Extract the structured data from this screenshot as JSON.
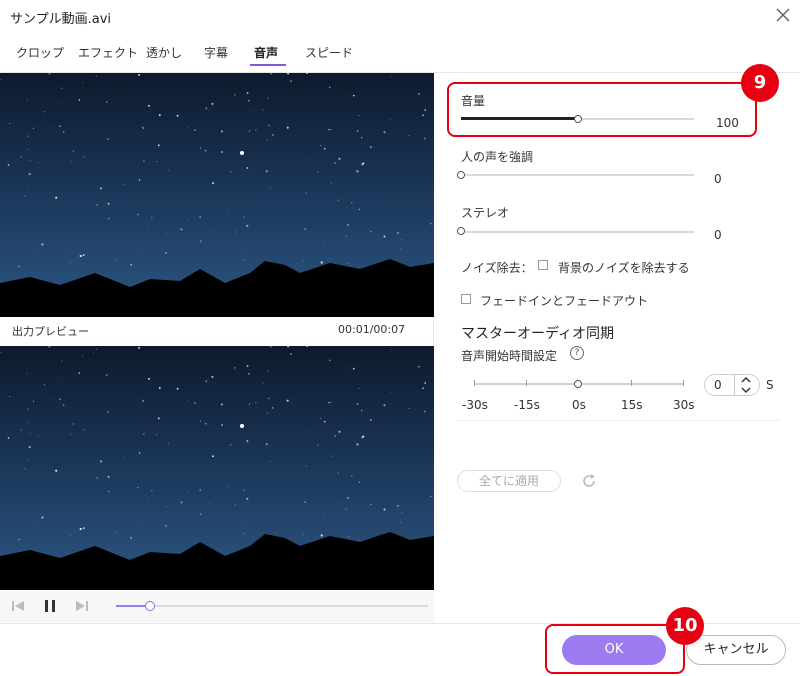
{
  "window": {
    "title": "サンプル動画.avi"
  },
  "tabs": [
    {
      "label": "クロップ"
    },
    {
      "label": "エフェクト"
    },
    {
      "label": "透かし"
    },
    {
      "label": "字幕"
    },
    {
      "label": "音声"
    },
    {
      "label": "スピード"
    }
  ],
  "active_tab": "音声",
  "preview": {
    "output_label": "出力プレビュー",
    "timecode": "00:01/00:07",
    "progress": 0.11
  },
  "audio": {
    "volume": {
      "label": "音量",
      "value": "100",
      "level": 0.5
    },
    "voice_enhance": {
      "label": "人の声を強調",
      "value": "0",
      "level": 0
    },
    "stereo": {
      "label": "ステレオ",
      "value": "0",
      "level": 0
    },
    "noise": {
      "label": "ノイズ除去：",
      "checkbox_label": "背景のノイズを除去する",
      "checked": false
    },
    "fade": {
      "label": "フェードインとフェードアウト",
      "checked": false
    }
  },
  "master_sync": {
    "title": "マスターオーディオ同期",
    "subtitle": "音声開始時間設定",
    "help_icon": "?",
    "ticks": [
      "-30s",
      "-15s",
      "0s",
      "15s",
      "30s"
    ],
    "offset_value": "0",
    "unit": "S"
  },
  "buttons": {
    "apply_all": "全てに適用",
    "ok": "OK",
    "cancel": "キャンセル"
  },
  "annotations": {
    "badge_volume": "9",
    "badge_ok": "10"
  },
  "colors": {
    "accent": "#9b7bef",
    "highlight": "#e60012"
  }
}
